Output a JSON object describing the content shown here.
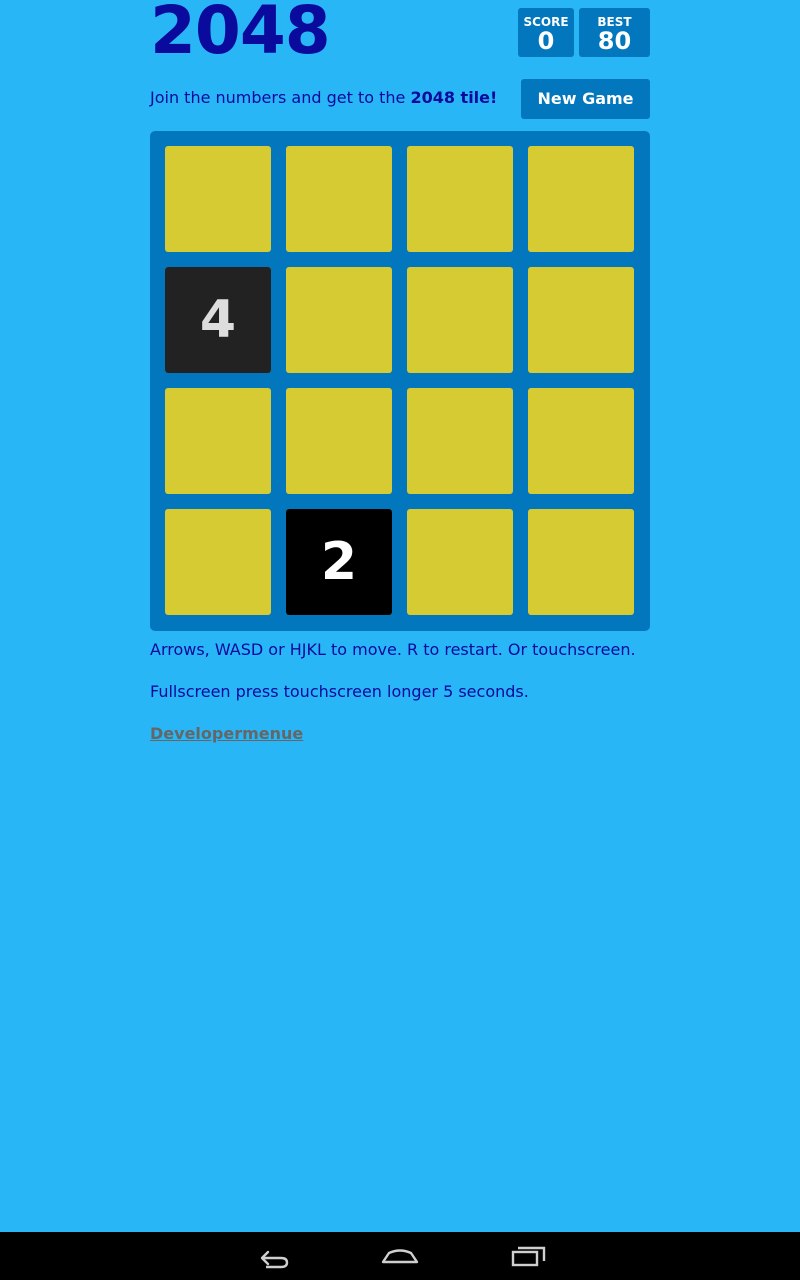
{
  "header": {
    "title": "2048",
    "score_label": "SCORE",
    "score_value": "0",
    "best_label": "BEST",
    "best_value": "80"
  },
  "intro": {
    "text_prefix": "Join the numbers and get to the ",
    "text_bold": "2048 tile!"
  },
  "new_game_label": "New Game",
  "board": {
    "rows": [
      [
        "",
        "",
        "",
        ""
      ],
      [
        "4",
        "",
        "",
        ""
      ],
      [
        "",
        "",
        "",
        ""
      ],
      [
        "",
        "2",
        "",
        ""
      ]
    ]
  },
  "tile_colors": {
    "empty": "#d6cb33",
    "2": "#000000",
    "4": "#222222"
  },
  "help": {
    "controls": "Arrows, WASD or HJKL to move. R to restart. Or touchscreen.",
    "fullscreen": "Fullscreen press touchscreen longer 5 seconds.",
    "developer_link": "Developermenue"
  },
  "navbar": {
    "icons": [
      "back-icon",
      "home-icon",
      "recent-apps-icon"
    ]
  }
}
